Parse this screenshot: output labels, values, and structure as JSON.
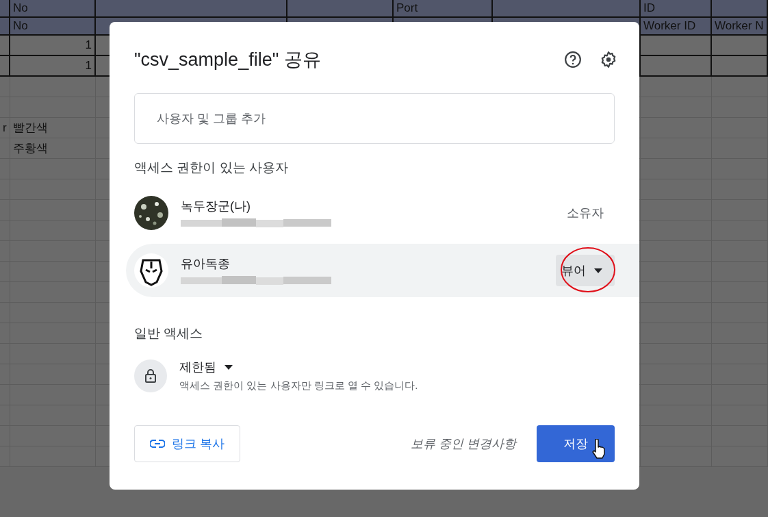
{
  "sheet": {
    "rows": [
      {
        "kind": "header",
        "cells": [
          null,
          "No",
          null,
          null,
          "Port",
          null,
          "ID",
          null
        ]
      },
      {
        "kind": "header",
        "cells": [
          null,
          "No",
          null,
          null,
          null,
          null,
          "Worker ID",
          "Worker N"
        ]
      },
      {
        "kind": "data",
        "cells": [
          null,
          "1",
          null,
          null,
          null,
          null,
          null,
          null
        ]
      },
      {
        "kind": "data",
        "cells": [
          null,
          "1",
          null,
          null,
          null,
          null,
          null,
          null
        ]
      },
      {
        "kind": "plain",
        "cells": [
          null,
          null,
          null,
          null,
          null,
          null,
          null,
          null
        ]
      },
      {
        "kind": "plain",
        "cells": [
          null,
          null,
          null,
          null,
          null,
          null,
          null,
          null
        ]
      },
      {
        "kind": "plain",
        "cells": [
          "r",
          "빨간색",
          null,
          null,
          null,
          null,
          null,
          null
        ]
      },
      {
        "kind": "plain",
        "cells": [
          null,
          "주황색",
          null,
          null,
          null,
          null,
          null,
          null
        ]
      },
      {
        "kind": "plain",
        "cells": [
          null,
          null,
          null,
          null,
          null,
          null,
          null,
          null
        ]
      },
      {
        "kind": "plain",
        "cells": [
          null,
          null,
          null,
          null,
          null,
          null,
          null,
          null
        ]
      },
      {
        "kind": "plain",
        "cells": [
          null,
          null,
          null,
          null,
          null,
          null,
          null,
          null
        ]
      },
      {
        "kind": "plain",
        "cells": [
          null,
          null,
          null,
          null,
          null,
          null,
          null,
          null
        ]
      },
      {
        "kind": "plain",
        "cells": [
          null,
          null,
          null,
          null,
          null,
          null,
          null,
          null
        ]
      },
      {
        "kind": "plain",
        "cells": [
          null,
          null,
          null,
          null,
          null,
          null,
          null,
          null
        ]
      },
      {
        "kind": "plain",
        "cells": [
          null,
          null,
          null,
          null,
          null,
          null,
          null,
          null
        ]
      },
      {
        "kind": "plain",
        "cells": [
          null,
          null,
          null,
          null,
          null,
          null,
          null,
          null
        ]
      },
      {
        "kind": "plain",
        "cells": [
          null,
          null,
          null,
          null,
          null,
          null,
          null,
          null
        ]
      },
      {
        "kind": "plain",
        "cells": [
          null,
          null,
          null,
          null,
          null,
          null,
          null,
          null
        ]
      },
      {
        "kind": "plain",
        "cells": [
          null,
          null,
          null,
          null,
          null,
          null,
          null,
          null
        ]
      },
      {
        "kind": "plain",
        "cells": [
          null,
          null,
          null,
          null,
          null,
          null,
          null,
          null
        ]
      },
      {
        "kind": "plain",
        "cells": [
          null,
          null,
          null,
          null,
          null,
          null,
          null,
          null
        ]
      },
      {
        "kind": "plain",
        "cells": [
          null,
          null,
          null,
          null,
          null,
          null,
          null,
          null
        ]
      },
      {
        "kind": "plain",
        "cells": [
          null,
          null,
          null,
          null,
          null,
          null,
          null,
          null
        ]
      }
    ]
  },
  "dialog": {
    "title": "\"csv_sample_file\" 공유",
    "search": {
      "placeholder": "사용자 및 그룹 추가"
    },
    "people_heading": "액세스 권한이 있는 사용자",
    "people": [
      {
        "name": "녹두장군(나)",
        "role": "소유자",
        "kind": "static",
        "selected": false
      },
      {
        "name": "유아독종",
        "role": "뷰어",
        "kind": "dropdown",
        "selected": true
      }
    ],
    "general_heading": "일반 액세스",
    "access": {
      "label": "제한됨",
      "description": "액세스 권한이 있는 사용자만 링크로 열 수 있습니다."
    },
    "copy_link": "링크 복사",
    "pending": "보류 중인 변경사항",
    "save": "저장"
  }
}
